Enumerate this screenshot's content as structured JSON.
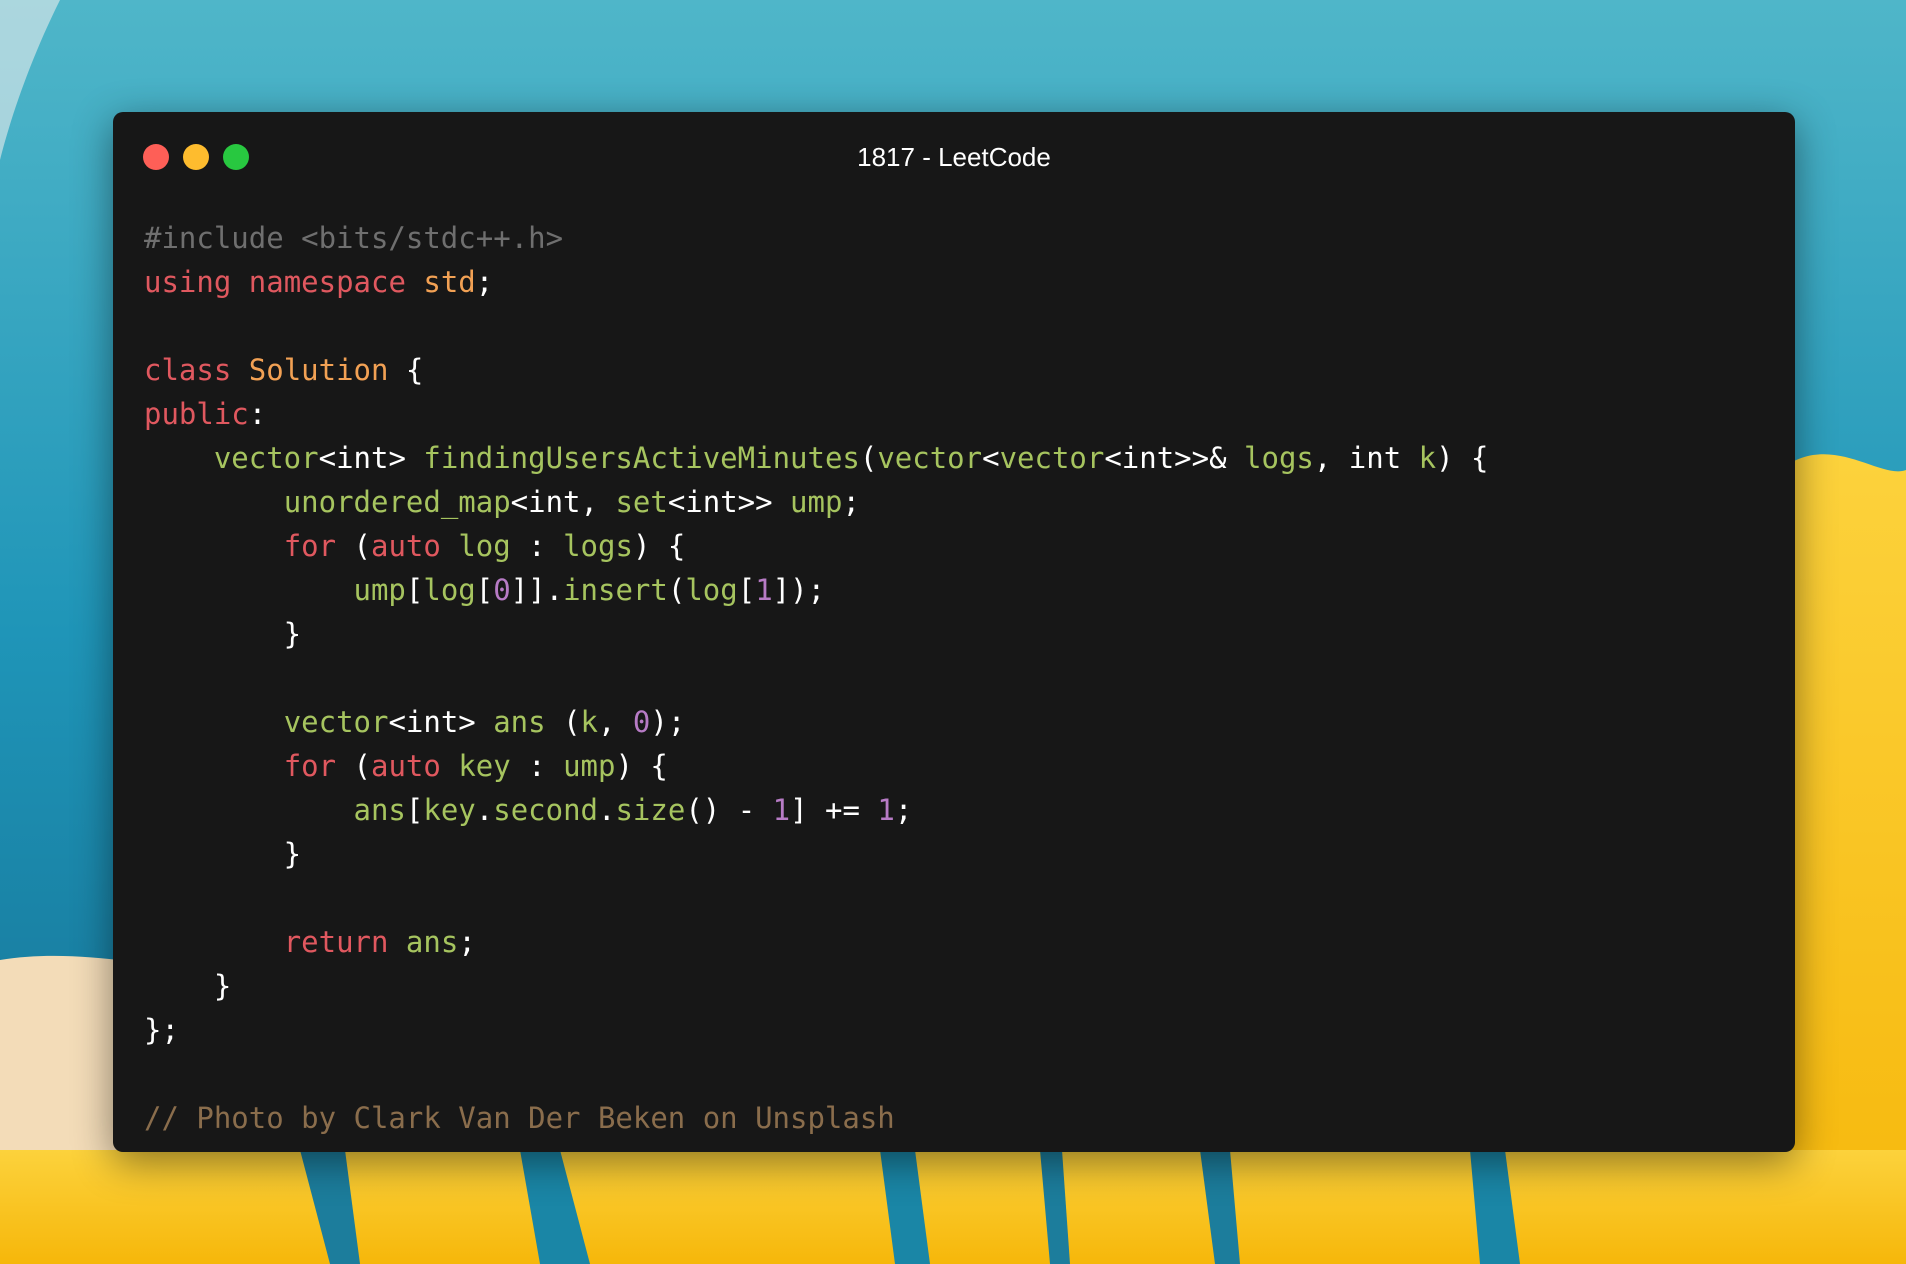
{
  "window": {
    "title": "1817 - LeetCode",
    "controls": [
      "close",
      "minimize",
      "zoom"
    ]
  },
  "colors": {
    "window_bg": "#171717",
    "close": "#fe5f57",
    "minimize": "#febc2e",
    "zoom": "#28c840",
    "keyword": "#e0585f",
    "type_name": "#f2a154",
    "identifier": "#a6c45f",
    "number": "#b77bc5",
    "punctuation": "#ffffff",
    "preprocessor": "#6f6f6f",
    "comment": "#8a6d4c",
    "background_teal": "#1f95b8",
    "background_yellow": "#fbbf16"
  },
  "code": {
    "language": "cpp",
    "lines": [
      [
        {
          "t": "#include <bits/stdc++.h>",
          "c": "pre"
        }
      ],
      [
        {
          "t": "using",
          "c": "kw"
        },
        {
          "t": " ",
          "c": "p"
        },
        {
          "t": "namespace",
          "c": "kw"
        },
        {
          "t": " ",
          "c": "p"
        },
        {
          "t": "std",
          "c": "type"
        },
        {
          "t": ";",
          "c": "p"
        }
      ],
      [],
      [
        {
          "t": "class",
          "c": "kw"
        },
        {
          "t": " ",
          "c": "p"
        },
        {
          "t": "Solution",
          "c": "type"
        },
        {
          "t": " {",
          "c": "p"
        }
      ],
      [
        {
          "t": "public",
          "c": "kw"
        },
        {
          "t": ":",
          "c": "p"
        }
      ],
      [
        {
          "t": "    ",
          "c": "p"
        },
        {
          "t": "vector",
          "c": "id"
        },
        {
          "t": "<int> ",
          "c": "p"
        },
        {
          "t": "findingUsersActiveMinutes",
          "c": "fn"
        },
        {
          "t": "(",
          "c": "p"
        },
        {
          "t": "vector",
          "c": "id"
        },
        {
          "t": "<",
          "c": "p"
        },
        {
          "t": "vector",
          "c": "id"
        },
        {
          "t": "<int>>& ",
          "c": "p"
        },
        {
          "t": "logs",
          "c": "id"
        },
        {
          "t": ", int ",
          "c": "p"
        },
        {
          "t": "k",
          "c": "id"
        },
        {
          "t": ") {",
          "c": "p"
        }
      ],
      [
        {
          "t": "        ",
          "c": "p"
        },
        {
          "t": "unordered_map",
          "c": "id"
        },
        {
          "t": "<int, ",
          "c": "p"
        },
        {
          "t": "set",
          "c": "id"
        },
        {
          "t": "<int>> ",
          "c": "p"
        },
        {
          "t": "ump",
          "c": "id"
        },
        {
          "t": ";",
          "c": "p"
        }
      ],
      [
        {
          "t": "        ",
          "c": "p"
        },
        {
          "t": "for",
          "c": "kw"
        },
        {
          "t": " (",
          "c": "p"
        },
        {
          "t": "auto",
          "c": "kw"
        },
        {
          "t": " ",
          "c": "p"
        },
        {
          "t": "log",
          "c": "id"
        },
        {
          "t": " : ",
          "c": "p"
        },
        {
          "t": "logs",
          "c": "id"
        },
        {
          "t": ") {",
          "c": "p"
        }
      ],
      [
        {
          "t": "            ",
          "c": "p"
        },
        {
          "t": "ump",
          "c": "id"
        },
        {
          "t": "[",
          "c": "p"
        },
        {
          "t": "log",
          "c": "id"
        },
        {
          "t": "[",
          "c": "p"
        },
        {
          "t": "0",
          "c": "num"
        },
        {
          "t": "]].",
          "c": "p"
        },
        {
          "t": "insert",
          "c": "fn"
        },
        {
          "t": "(",
          "c": "p"
        },
        {
          "t": "log",
          "c": "id"
        },
        {
          "t": "[",
          "c": "p"
        },
        {
          "t": "1",
          "c": "num"
        },
        {
          "t": "]);",
          "c": "p"
        }
      ],
      [
        {
          "t": "        }",
          "c": "p"
        }
      ],
      [],
      [
        {
          "t": "        ",
          "c": "p"
        },
        {
          "t": "vector",
          "c": "id"
        },
        {
          "t": "<int> ",
          "c": "p"
        },
        {
          "t": "ans",
          "c": "id"
        },
        {
          "t": " (",
          "c": "p"
        },
        {
          "t": "k",
          "c": "id"
        },
        {
          "t": ", ",
          "c": "p"
        },
        {
          "t": "0",
          "c": "num"
        },
        {
          "t": ");",
          "c": "p"
        }
      ],
      [
        {
          "t": "        ",
          "c": "p"
        },
        {
          "t": "for",
          "c": "kw"
        },
        {
          "t": " (",
          "c": "p"
        },
        {
          "t": "auto",
          "c": "kw"
        },
        {
          "t": " ",
          "c": "p"
        },
        {
          "t": "key",
          "c": "id"
        },
        {
          "t": " : ",
          "c": "p"
        },
        {
          "t": "ump",
          "c": "id"
        },
        {
          "t": ") {",
          "c": "p"
        }
      ],
      [
        {
          "t": "            ",
          "c": "p"
        },
        {
          "t": "ans",
          "c": "id"
        },
        {
          "t": "[",
          "c": "p"
        },
        {
          "t": "key",
          "c": "id"
        },
        {
          "t": ".",
          "c": "p"
        },
        {
          "t": "second",
          "c": "id"
        },
        {
          "t": ".",
          "c": "p"
        },
        {
          "t": "size",
          "c": "fn"
        },
        {
          "t": "() - ",
          "c": "p"
        },
        {
          "t": "1",
          "c": "num"
        },
        {
          "t": "] += ",
          "c": "p"
        },
        {
          "t": "1",
          "c": "num"
        },
        {
          "t": ";",
          "c": "p"
        }
      ],
      [
        {
          "t": "        }",
          "c": "p"
        }
      ],
      [],
      [
        {
          "t": "        ",
          "c": "p"
        },
        {
          "t": "return",
          "c": "kw"
        },
        {
          "t": " ",
          "c": "p"
        },
        {
          "t": "ans",
          "c": "id"
        },
        {
          "t": ";",
          "c": "p"
        }
      ],
      [
        {
          "t": "    }",
          "c": "p"
        }
      ],
      [
        {
          "t": "};",
          "c": "p"
        }
      ],
      [],
      [
        {
          "t": "// Photo by Clark Van Der Beken on Unsplash",
          "c": "cm"
        }
      ]
    ]
  }
}
